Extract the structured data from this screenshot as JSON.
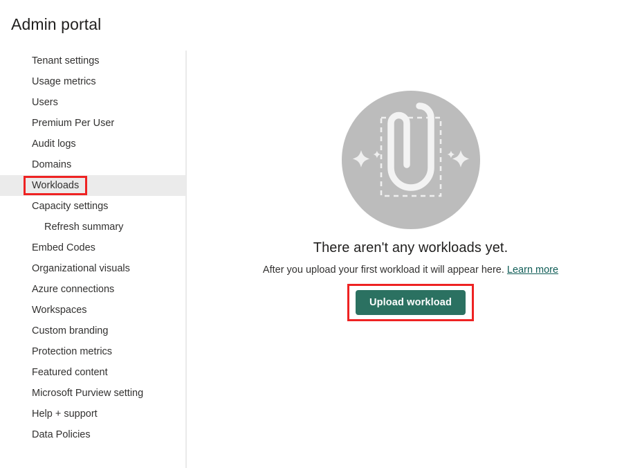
{
  "page": {
    "title": "Admin portal"
  },
  "colors": {
    "accent_button": "#2b7161",
    "annotation": "#ee2222",
    "selected_row": "#ebebeb",
    "illustration_circle": "#bcbcbc",
    "link": "#0f5c56"
  },
  "sidebar": {
    "items": [
      {
        "label": "Tenant settings",
        "sub": false,
        "selected": false,
        "annotated": false
      },
      {
        "label": "Usage metrics",
        "sub": false,
        "selected": false,
        "annotated": false
      },
      {
        "label": "Users",
        "sub": false,
        "selected": false,
        "annotated": false
      },
      {
        "label": "Premium Per User",
        "sub": false,
        "selected": false,
        "annotated": false
      },
      {
        "label": "Audit logs",
        "sub": false,
        "selected": false,
        "annotated": false
      },
      {
        "label": "Domains",
        "sub": false,
        "selected": false,
        "annotated": false
      },
      {
        "label": "Workloads",
        "sub": false,
        "selected": true,
        "annotated": true
      },
      {
        "label": "Capacity settings",
        "sub": false,
        "selected": false,
        "annotated": false
      },
      {
        "label": "Refresh summary",
        "sub": true,
        "selected": false,
        "annotated": false
      },
      {
        "label": "Embed Codes",
        "sub": false,
        "selected": false,
        "annotated": false
      },
      {
        "label": "Organizational visuals",
        "sub": false,
        "selected": false,
        "annotated": false
      },
      {
        "label": "Azure connections",
        "sub": false,
        "selected": false,
        "annotated": false
      },
      {
        "label": "Workspaces",
        "sub": false,
        "selected": false,
        "annotated": false
      },
      {
        "label": "Custom branding",
        "sub": false,
        "selected": false,
        "annotated": false
      },
      {
        "label": "Protection metrics",
        "sub": false,
        "selected": false,
        "annotated": false
      },
      {
        "label": "Featured content",
        "sub": false,
        "selected": false,
        "annotated": false
      },
      {
        "label": "Microsoft Purview setting",
        "sub": false,
        "selected": false,
        "annotated": false
      },
      {
        "label": "Help + support",
        "sub": false,
        "selected": false,
        "annotated": false
      },
      {
        "label": "Data Policies",
        "sub": false,
        "selected": false,
        "annotated": false
      }
    ]
  },
  "main": {
    "empty_state": {
      "illustration_icon": "paperclip-upload-illustration",
      "heading": "There aren't any workloads yet.",
      "description": "After you upload your first workload it will appear here.",
      "learn_more_label": "Learn more",
      "upload_button_label": "Upload workload"
    }
  }
}
